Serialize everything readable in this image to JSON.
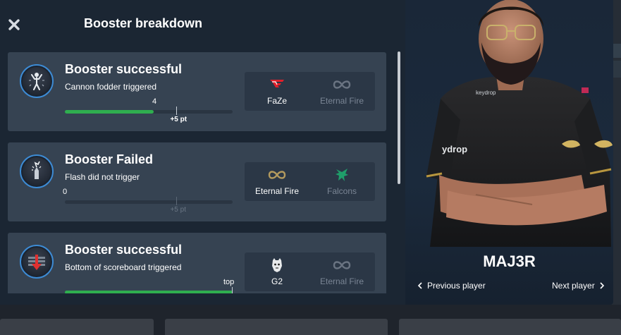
{
  "modal": {
    "title": "Booster breakdown",
    "close_icon": "close-icon"
  },
  "boosters": [
    {
      "title": "Booster successful",
      "subtitle": "Cannon fodder triggered",
      "icon": "cannon-fodder-icon",
      "value_label": "4",
      "points_label": "+5 pt",
      "progress": 0.53,
      "threshold": 0.67,
      "teams": [
        {
          "name": "FaZe",
          "icon": "faze-logo",
          "active": true
        },
        {
          "name": "Eternal Fire",
          "icon": "eternal-fire-logo",
          "active": false
        }
      ]
    },
    {
      "title": "Booster Failed",
      "subtitle": "Flash did not trigger",
      "icon": "flash-icon",
      "value_label": "0",
      "points_label": "+5 pt",
      "progress": 0.0,
      "threshold": 0.67,
      "teams": [
        {
          "name": "Eternal Fire",
          "icon": "eternal-fire-logo",
          "active": true
        },
        {
          "name": "Falcons",
          "icon": "falcons-logo",
          "active": false
        }
      ]
    },
    {
      "title": "Booster successful",
      "subtitle": "Bottom of scoreboard triggered",
      "icon": "bottom-scoreboard-icon",
      "value_label": "top",
      "points_label": "",
      "progress": 1.0,
      "threshold": 1.0,
      "teams": [
        {
          "name": "G2",
          "icon": "g2-logo",
          "active": true
        },
        {
          "name": "Eternal Fire",
          "icon": "eternal-fire-logo",
          "active": false
        }
      ]
    }
  ],
  "player": {
    "name": "MAJ3R",
    "prev_label": "Previous player",
    "next_label": "Next player"
  },
  "colors": {
    "success_green": "#2fae4f",
    "card_bg": "#364352",
    "modal_bg": "#1b2633",
    "badge_ring": "#3d8bd4",
    "faze_red": "#e2202b",
    "falcons_green": "#1f9e6a"
  }
}
